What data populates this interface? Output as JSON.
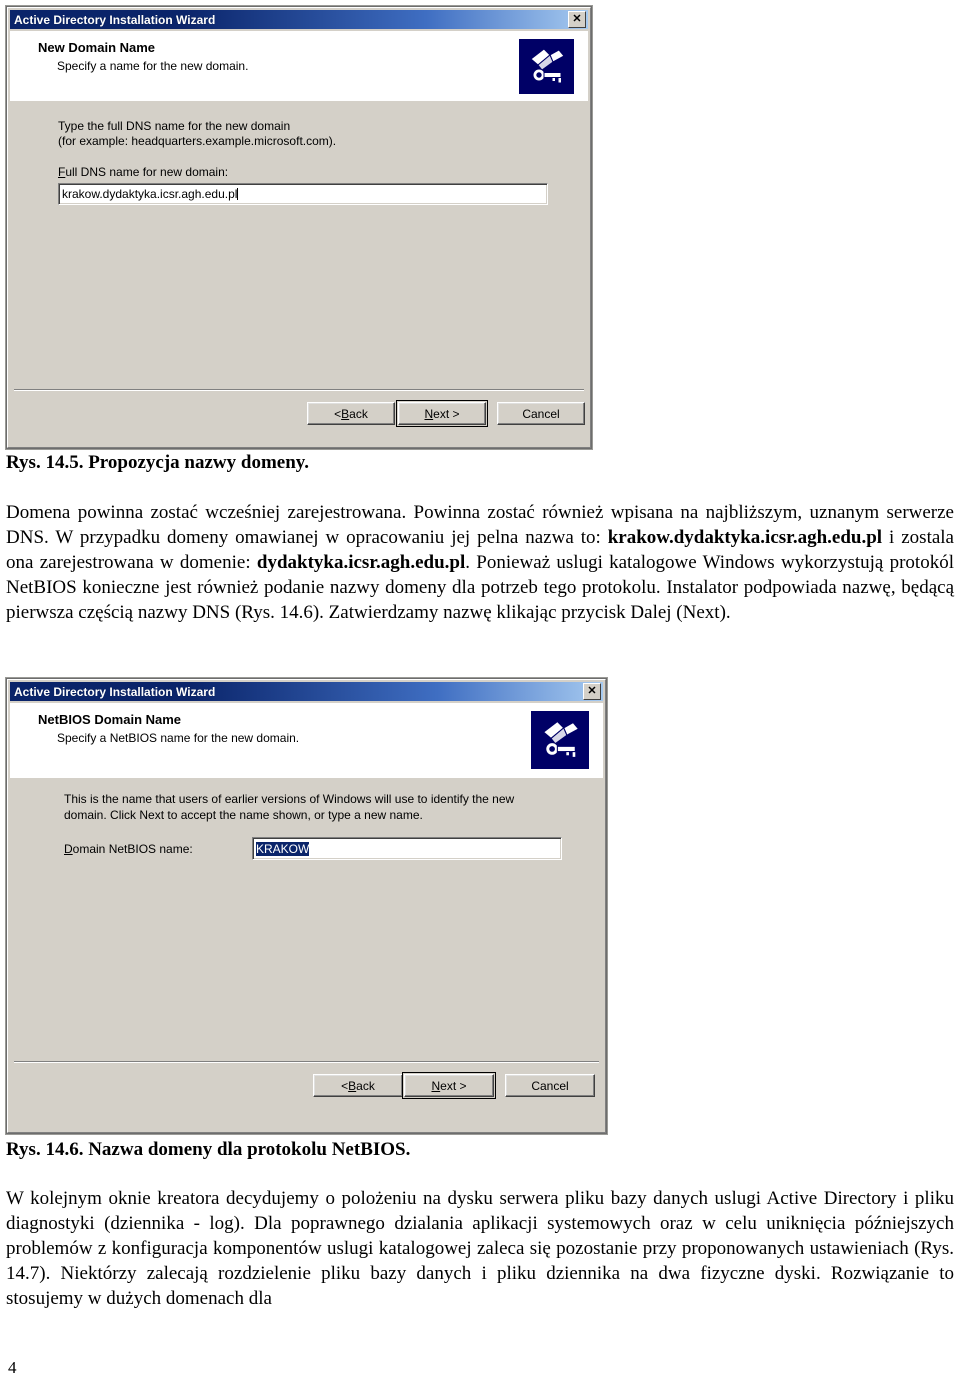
{
  "dialog1": {
    "titlebar": {
      "title": "Active Directory Installation Wizard",
      "close_label": "✕"
    },
    "header": {
      "title": "New Domain Name",
      "subtitle": "Specify a name for the new domain.",
      "icon": "ad-wizard-book-key-icon"
    },
    "body": {
      "instruction_line1": "Type the full DNS name for the new domain",
      "instruction_line2": "(for example: headquarters.example.microsoft.com).",
      "field_label_accesskey": "F",
      "field_label_rest": "ull DNS name for new domain:",
      "field_value": "krakow.dydaktyka.icsr.agh.edu.pl"
    },
    "buttons": {
      "back_prefix": "< ",
      "back_accesskey": "B",
      "back_rest": "ack",
      "next_accesskey": "N",
      "next_rest": "ext >",
      "cancel": "Cancel"
    }
  },
  "caption1": "Rys. 14.5. Propozycja nazwy domeny.",
  "paragraph1": {
    "part1": "Domena powinna zostać wcześniej zarejestrowana. Powinna zostać również wpisana na najbliższym, uznanym serwerze DNS. W przypadku domeny omawianej w opracowaniu jej pelna nazwa to: ",
    "bold1": "krakow.dydaktyka.icsr.agh.edu.pl",
    "part2": " i zostala ona zarejestrowana w domenie: ",
    "bold2": "dydaktyka.icsr.agh.edu.pl",
    "part3": ". Ponieważ uslugi katalogowe Windows wykorzystują protokól NetBIOS konieczne jest również podanie nazwy domeny dla potrzeb tego protokolu. Instalator podpowiada nazwę, będącą pierwsza częścią nazwy DNS (Rys. 14.6). Zatwierdzamy nazwę klikając przycisk Dalej (Next)."
  },
  "dialog2": {
    "titlebar": {
      "title": "Active Directory Installation Wizard",
      "close_label": "✕"
    },
    "header": {
      "title": "NetBIOS Domain Name",
      "subtitle": "Specify a NetBIOS name for the new domain.",
      "icon": "ad-wizard-book-key-icon"
    },
    "body": {
      "instruction_line1": "This is the name that users of earlier versions of Windows will use to identify the new",
      "instruction_line2": "domain. Click Next to accept the name shown, or type a new name.",
      "field_label_accesskey": "D",
      "field_label_rest": "omain NetBIOS name:",
      "field_value": "KRAKOW"
    },
    "buttons": {
      "back_prefix": "< ",
      "back_accesskey": "B",
      "back_rest": "ack",
      "next_accesskey": "N",
      "next_rest": "ext >",
      "cancel": "Cancel"
    }
  },
  "caption2": "Rys. 14.6. Nazwa domeny dla protokolu NetBIOS.",
  "paragraph2": "W kolejnym oknie kreatora decydujemy o polożeniu na dysku serwera pliku bazy danych uslugi Active Directory i pliku diagnostyki (dziennika - log). Dla poprawnego dzialania aplikacji systemowych oraz w celu uniknięcia późniejszych problemów z konfiguracja komponentów uslugi katalogowej zaleca się pozostanie przy proponowanych ustawieniach (Rys. 14.7). Niektórzy zalecają rozdzielenie pliku bazy danych i pliku dziennika na dwa fizyczne dyski. Rozwiązanie to stosujemy w dużych domenach dla",
  "page_number": "4",
  "colors": {
    "titlebar_dark": "#0a246a",
    "titlebar_light": "#a6caf0",
    "dialog_face": "#d4d0c8",
    "icon_bg": "#000066",
    "selection": "#0a246a"
  }
}
